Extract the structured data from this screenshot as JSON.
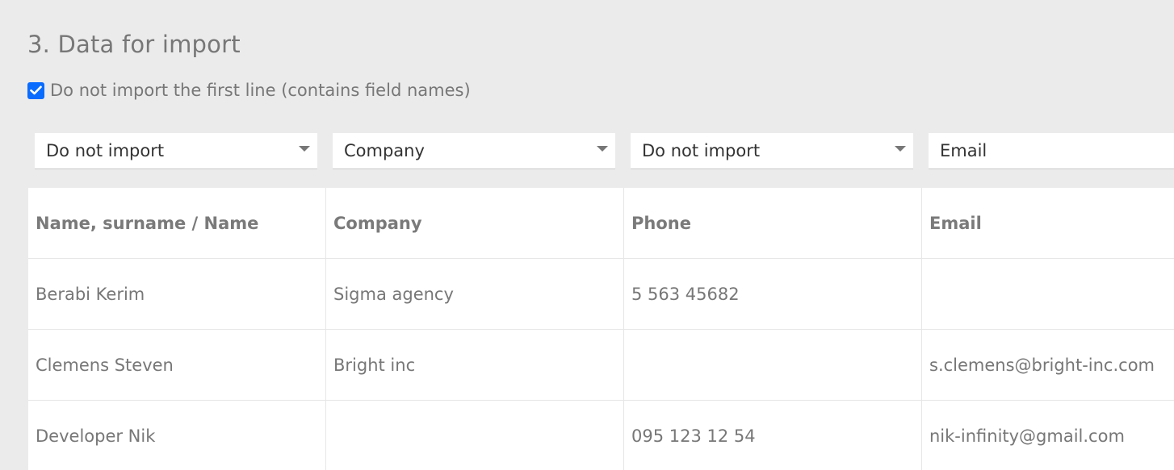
{
  "section": {
    "title": "3. Data for import"
  },
  "skip_first_line": {
    "checked": true,
    "label": "Do not import the first line (contains field names)"
  },
  "mapping": [
    {
      "value": "Do not import",
      "has_arrow": true
    },
    {
      "value": "Company",
      "has_arrow": true
    },
    {
      "value": "Do not import",
      "has_arrow": true
    },
    {
      "value": "Email",
      "has_arrow": false
    }
  ],
  "table": {
    "headers": [
      "Name, surname / Name",
      "Company",
      "Phone",
      "Email"
    ],
    "rows": [
      [
        "Berabi Kerim",
        "Sigma agency",
        "5 563 45682",
        ""
      ],
      [
        "Clemens Steven",
        "Bright inc",
        "",
        "s.clemens@bright-inc.com"
      ],
      [
        "Developer Nik",
        "",
        "095 123 12 54",
        "nik-infinity@gmail.com"
      ]
    ]
  },
  "colors": {
    "page_background": "#ebebeb",
    "checkbox_accent": "#0a6cff",
    "text": "#777777"
  }
}
